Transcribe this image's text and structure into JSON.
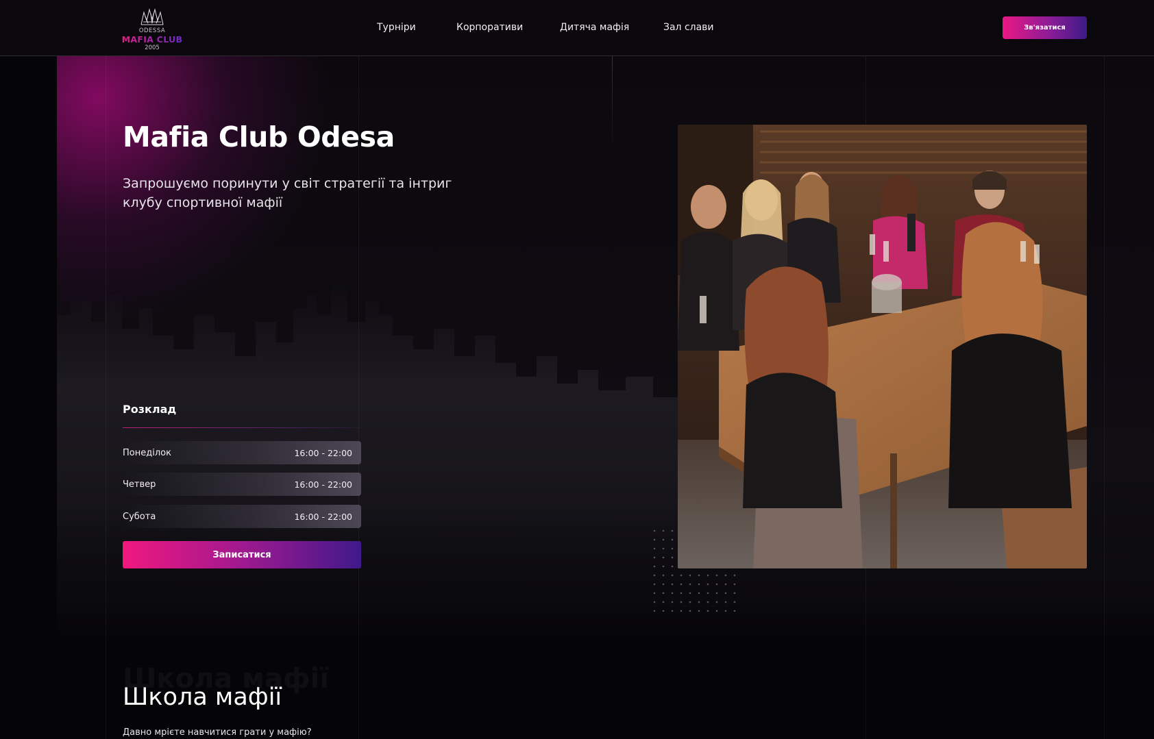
{
  "header": {
    "logo": {
      "top": "ODESSA",
      "name": "MAFIA CLUB",
      "year": "2005"
    },
    "nav": [
      {
        "label": "Турніри"
      },
      {
        "label": "Корпоративи"
      },
      {
        "label": "Дитяча мафія"
      },
      {
        "label": "Зал слави"
      }
    ],
    "contact_label": "Зв'язатися"
  },
  "hero": {
    "title": "Mafia Club Odesa",
    "subtitle": "Запрошуємо поринути у світ стратегії та інтриг клубу спортивної мафії",
    "schedule": {
      "title": "Розклад",
      "rows": [
        {
          "day": "Понеділок",
          "time": "16:00 - 22:00"
        },
        {
          "day": "Четвер",
          "time": "16:00 - 22:00"
        },
        {
          "day": "Субота",
          "time": "16:00 - 22:00"
        }
      ]
    },
    "signup_label": "Записатися",
    "image_icon": "group-photo"
  },
  "school": {
    "ghost_title": "Школа мафії",
    "title": "Школа мафії",
    "subtitle": "Давно мрієте навчитися грати у мафію?"
  },
  "colors": {
    "accent_pink": "#ea1784",
    "accent_purple": "#3d1b86",
    "background": "#050407"
  }
}
